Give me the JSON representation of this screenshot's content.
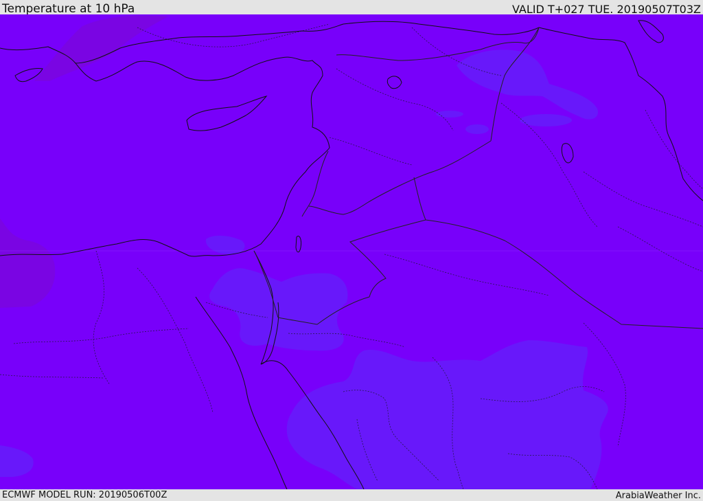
{
  "header": {
    "title": "Temperature at 10 hPa",
    "valid": "VALID T+027 TUE. 20190507T03Z"
  },
  "footer": {
    "model_run": "ECMWF MODEL RUN: 20190506T00Z",
    "credit": "ArabiaWeather Inc."
  },
  "map": {
    "colors": {
      "base_fill": "#7800fa",
      "cooler_fill": "#6818fa",
      "warmer_fill": "#7a06de",
      "coastline": "#111111",
      "borders": "#222222"
    }
  }
}
